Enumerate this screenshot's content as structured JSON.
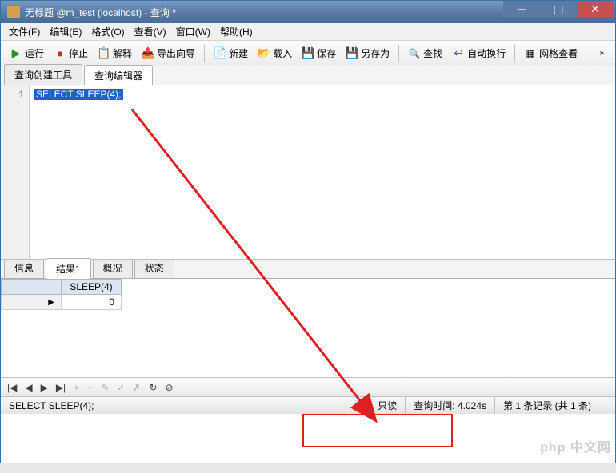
{
  "window": {
    "title": "无标题 @m_test (localhost) - 查询 *"
  },
  "menu": {
    "file": "文件(F)",
    "edit": "编辑(E)",
    "format": "格式(O)",
    "view": "查看(V)",
    "window": "窗口(W)",
    "help": "帮助(H)"
  },
  "toolbar": {
    "run": "运行",
    "stop": "停止",
    "explain": "解释",
    "export": "导出向导",
    "new": "新建",
    "load": "载入",
    "save": "保存",
    "saveas": "另存为",
    "find": "查找",
    "wordwrap": "自动换行",
    "gridview": "网格查看"
  },
  "tabs": {
    "builder": "查询创建工具",
    "editor": "查询编辑器"
  },
  "editor": {
    "linenum": "1",
    "code": "SELECT SLEEP(4);"
  },
  "result_tabs": {
    "info": "信息",
    "result1": "结果1",
    "profile": "概况",
    "status": "状态"
  },
  "grid": {
    "header": "SLEEP(4)",
    "value": "0"
  },
  "statusbar": {
    "query": "SELECT SLEEP(4);",
    "readonly": "只读",
    "querytime": "查询时间: 4.024s",
    "records": "第 1 条记录 (共 1 条)"
  },
  "watermark": "php 中文网"
}
